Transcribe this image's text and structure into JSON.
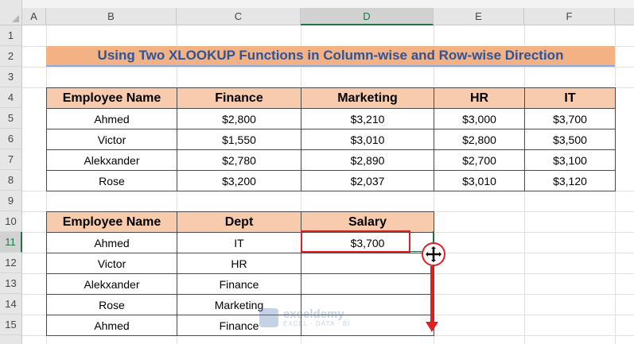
{
  "columns": [
    "A",
    "B",
    "C",
    "D",
    "E",
    "F"
  ],
  "rows": [
    "1",
    "2",
    "3",
    "4",
    "5",
    "6",
    "7",
    "8",
    "9",
    "10",
    "11",
    "12",
    "13",
    "14",
    "15"
  ],
  "title": "Using Two XLOOKUP Functions in Column-wise and Row-wise Direction",
  "table1": {
    "headers": [
      "Employee Name",
      "Finance",
      "Marketing",
      "HR",
      "IT"
    ],
    "rows": [
      [
        "Ahmed",
        "$2,800",
        "$3,210",
        "$3,000",
        "$3,700"
      ],
      [
        "Victor",
        "$1,550",
        "$3,010",
        "$2,800",
        "$3,500"
      ],
      [
        "Alekxander",
        "$2,780",
        "$2,890",
        "$2,700",
        "$3,100"
      ],
      [
        "Rose",
        "$3,200",
        "$2,037",
        "$3,010",
        "$3,120"
      ]
    ]
  },
  "table2": {
    "headers": [
      "Employee Name",
      "Dept",
      "Salary"
    ],
    "rows": [
      [
        "Ahmed",
        "IT",
        "$3,700"
      ],
      [
        "Victor",
        "HR",
        ""
      ],
      [
        "Alekxander",
        "Finance",
        ""
      ],
      [
        "Rose",
        "Marketing",
        ""
      ],
      [
        "Ahmed",
        "Finance",
        ""
      ]
    ]
  },
  "selected_cell": "D11",
  "watermark": {
    "name": "exceldemy",
    "tagline": "EXCEL · DATA · BI"
  },
  "colors": {
    "title_fill": "#f4b183",
    "header_fill": "#f8cbad",
    "title_text": "#2f5496",
    "accent": "#e02020",
    "excel_green": "#217346"
  },
  "icons": [
    "fill-handle-crosshair-icon",
    "down-arrow-icon",
    "exceldemy-logo-icon"
  ]
}
